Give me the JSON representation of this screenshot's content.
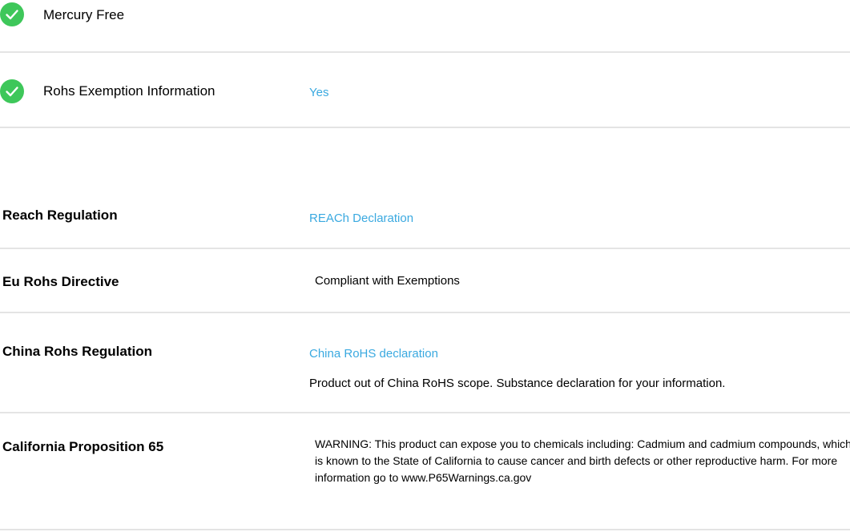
{
  "features": [
    {
      "label": "Mercury Free",
      "value": "",
      "icon": "check-circle-icon"
    },
    {
      "label": "Rohs Exemption Information",
      "value": "Yes",
      "icon": "check-circle-icon"
    }
  ],
  "regulations": {
    "reach": {
      "label": "Reach Regulation",
      "link": "REACh Declaration"
    },
    "eu_rohs": {
      "label": "Eu Rohs Directive",
      "value": "Compliant with Exemptions"
    },
    "china_rohs": {
      "label": "China Rohs Regulation",
      "link": "China RoHS declaration",
      "note": "Product out of China RoHS scope. Substance declaration for your information."
    },
    "ca_prop65": {
      "label": "California Proposition 65",
      "warning": "WARNING: This product can expose you to chemicals including: Cadmium and cadmium compounds, which is known to the State of California to cause cancer and birth defects or other reproductive harm. For more information go to www.P65Warnings.ca.gov"
    }
  },
  "colors": {
    "check_green": "#3ec75a",
    "link_blue": "#3aa9e0",
    "divider": "#e4e4e4"
  }
}
